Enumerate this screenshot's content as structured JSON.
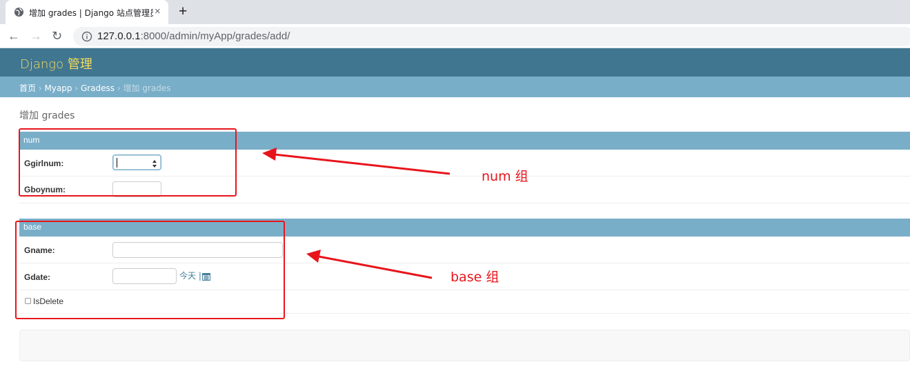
{
  "browser": {
    "tab_title": "增加 grades | Django 站点管理员",
    "tab_close": "×",
    "new_tab": "+",
    "back": "←",
    "forward": "→",
    "reload": "↻",
    "url_host": "127.0.0.1",
    "url_rest": ":8000/admin/myApp/grades/add/"
  },
  "header": {
    "brand": "Django 管理"
  },
  "breadcrumbs": {
    "home": "首页",
    "sep": " › ",
    "app": "Myapp",
    "model": "Gradess",
    "current": "增加 grades"
  },
  "page": {
    "title": "增加 grades"
  },
  "fieldsets": {
    "num": {
      "title": "num",
      "ggirlnum_label": "Ggirlnum:",
      "gboynum_label": "Gboynum:"
    },
    "base": {
      "title": "base",
      "gname_label": "Gname:",
      "gdate_label": "Gdate:",
      "today_link": "今天",
      "today_sep": " |",
      "isdelete_label": "IsDelete"
    }
  },
  "annotations": {
    "num_group": "num 组",
    "base_group": "base 组",
    "color": "#e8141b"
  },
  "colors": {
    "header_bg": "#417690",
    "brand": "#f5dd5d",
    "module_bg": "#79aec8",
    "link": "#447e9b"
  },
  "icons": [
    "globe-icon",
    "info-icon",
    "calendar-icon",
    "spinner-icon"
  ]
}
